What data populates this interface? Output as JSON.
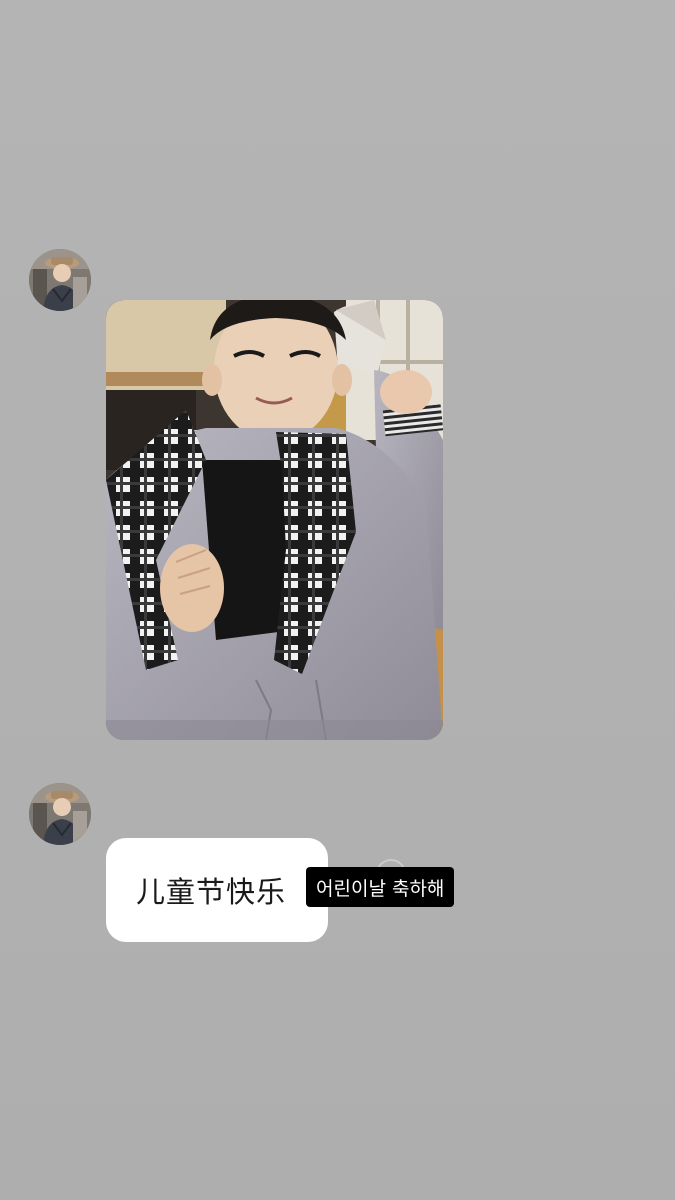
{
  "conversation": {
    "messages": [
      {
        "type": "image",
        "sender_avatar": "avatar-photo"
      },
      {
        "type": "text",
        "text": "儿童节快乐"
      }
    ]
  },
  "caption": {
    "text": "어린이날 축하해"
  },
  "colors": {
    "background": "#b2b2b2",
    "bubble": "#ffffff",
    "caption_bg": "#000000",
    "caption_text": "#ffffff"
  },
  "icons": [
    "avatar-image",
    "reaction-icon"
  ]
}
